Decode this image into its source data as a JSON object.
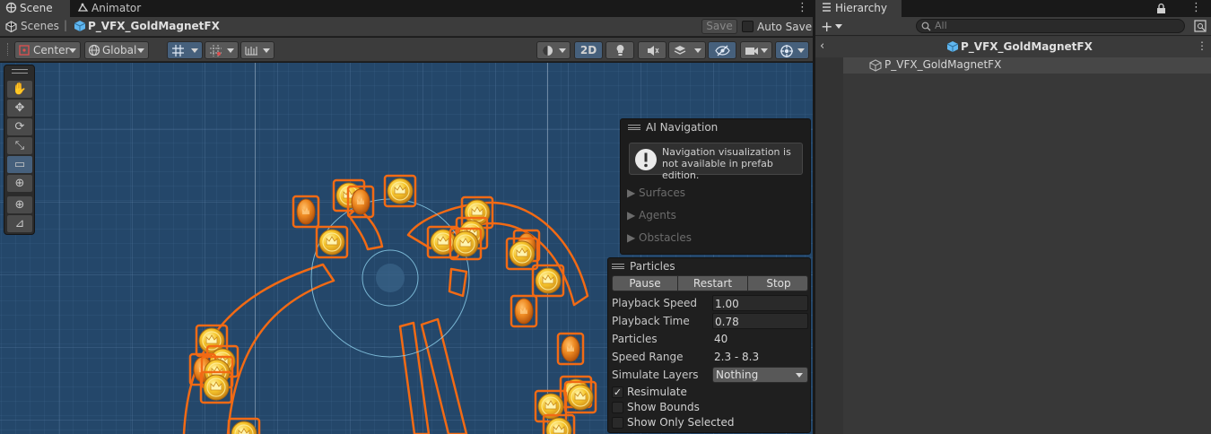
{
  "tabs": {
    "scene": "Scene",
    "animator": "Animator",
    "hierarchy": "Hierarchy"
  },
  "scene_header": {
    "breadcrumb_root": "Scenes",
    "prefab_name": "P_VFX_GoldMagnetFX",
    "save_label": "Save",
    "auto_save_label": "Auto Save",
    "auto_save_checked": false
  },
  "toolbar": {
    "pivot_mode": "Center",
    "pivot_rotation": "Global",
    "mode_2d": "2D"
  },
  "ai_navigation": {
    "title": "AI Navigation",
    "message": "Navigation visualization is not available in prefab edition.",
    "sections": [
      "Surfaces",
      "Agents",
      "Obstacles"
    ]
  },
  "particles": {
    "title": "Particles",
    "buttons": [
      "Pause",
      "Restart",
      "Stop"
    ],
    "rows": [
      {
        "label": "Playback Speed",
        "value": "1.00",
        "field": true
      },
      {
        "label": "Playback Time",
        "value": "0.78",
        "field": true
      },
      {
        "label": "Particles",
        "value": "40",
        "field": false
      },
      {
        "label": "Speed Range",
        "value": "2.3 - 8.3",
        "field": false
      }
    ],
    "simulate_layers_label": "Simulate Layers",
    "simulate_layers_value": "Nothing",
    "checkboxes": [
      {
        "label": "Resimulate",
        "checked": true
      },
      {
        "label": "Show Bounds",
        "checked": false
      },
      {
        "label": "Show Only Selected",
        "checked": false
      }
    ]
  },
  "hierarchy": {
    "search_placeholder": "All",
    "prefab_header": "P_VFX_GoldMagnetFX",
    "items": [
      "P_VFX_GoldMagnetFX"
    ]
  },
  "colors": {
    "scene_bg": "#24476a",
    "selection_outline": "#f26a14",
    "accent_blue": "#46607c",
    "prefab_icon": "#5fb6f0"
  }
}
